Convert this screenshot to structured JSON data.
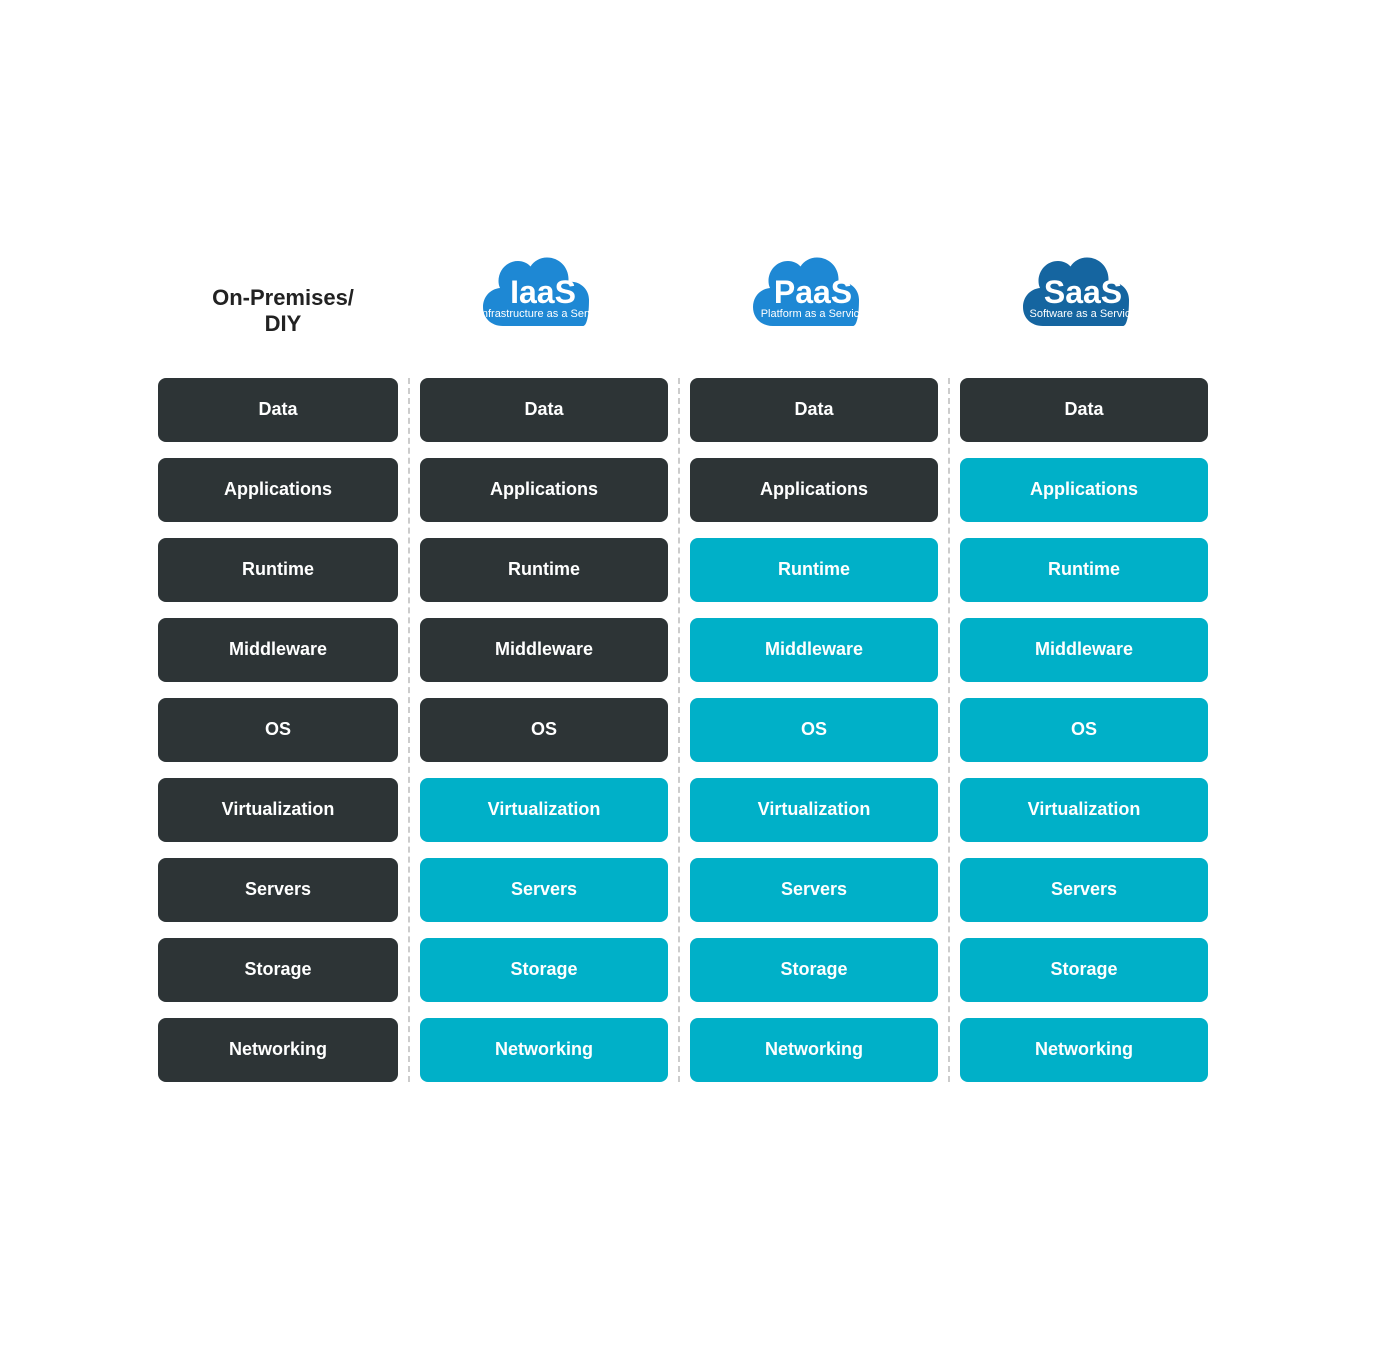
{
  "columns": {
    "onprem": {
      "label_line1": "On-Premises/",
      "label_line2": "DIY"
    },
    "iaas": {
      "title": "IaaS",
      "subtitle": "Infrastructure as a Service",
      "cloud_color": "#1e73be"
    },
    "paas": {
      "title": "PaaS",
      "subtitle": "Platform as a Service",
      "cloud_color": "#1e73be"
    },
    "saas": {
      "title": "SaaS",
      "subtitle": "Software as a Service",
      "cloud_color": "#1565a0"
    }
  },
  "rows": [
    {
      "label": "Data",
      "onprem": "dark",
      "iaas": "dark",
      "paas": "dark",
      "saas": "dark"
    },
    {
      "label": "Applications",
      "onprem": "dark",
      "iaas": "dark",
      "paas": "dark",
      "saas": "teal"
    },
    {
      "label": "Runtime",
      "onprem": "dark",
      "iaas": "dark",
      "paas": "teal",
      "saas": "teal"
    },
    {
      "label": "Middleware",
      "onprem": "dark",
      "iaas": "dark",
      "paas": "teal",
      "saas": "teal"
    },
    {
      "label": "OS",
      "onprem": "dark",
      "iaas": "dark",
      "paas": "teal",
      "saas": "teal"
    },
    {
      "label": "Virtualization",
      "onprem": "dark",
      "iaas": "teal",
      "paas": "teal",
      "saas": "teal"
    },
    {
      "label": "Servers",
      "onprem": "dark",
      "iaas": "teal",
      "paas": "teal",
      "saas": "teal"
    },
    {
      "label": "Storage",
      "onprem": "dark",
      "iaas": "teal",
      "paas": "teal",
      "saas": "teal"
    },
    {
      "label": "Networking",
      "onprem": "dark",
      "iaas": "teal",
      "paas": "teal",
      "saas": "teal"
    }
  ]
}
